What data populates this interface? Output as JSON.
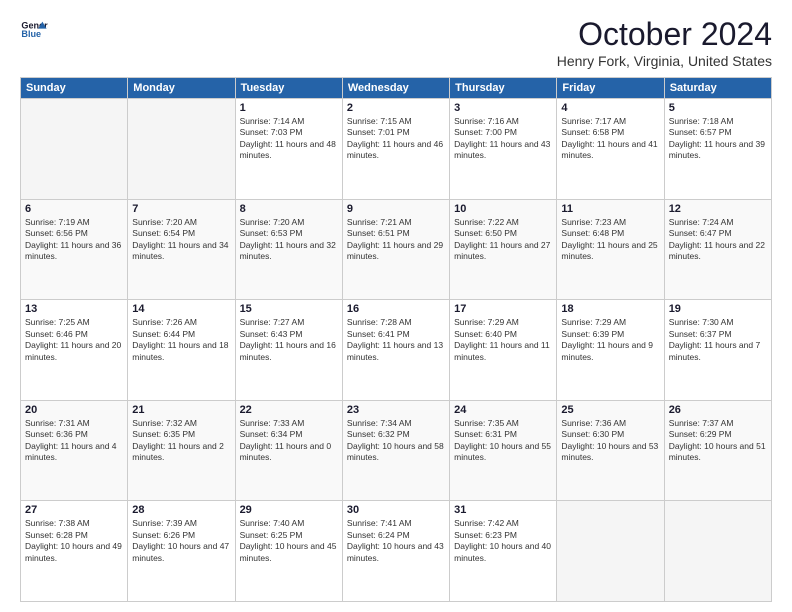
{
  "header": {
    "logo_line1": "General",
    "logo_line2": "Blue",
    "month": "October 2024",
    "location": "Henry Fork, Virginia, United States"
  },
  "weekdays": [
    "Sunday",
    "Monday",
    "Tuesday",
    "Wednesday",
    "Thursday",
    "Friday",
    "Saturday"
  ],
  "weeks": [
    [
      {
        "day": "",
        "empty": true
      },
      {
        "day": "",
        "empty": true
      },
      {
        "day": "1",
        "sunrise": "Sunrise: 7:14 AM",
        "sunset": "Sunset: 7:03 PM",
        "daylight": "Daylight: 11 hours and 48 minutes."
      },
      {
        "day": "2",
        "sunrise": "Sunrise: 7:15 AM",
        "sunset": "Sunset: 7:01 PM",
        "daylight": "Daylight: 11 hours and 46 minutes."
      },
      {
        "day": "3",
        "sunrise": "Sunrise: 7:16 AM",
        "sunset": "Sunset: 7:00 PM",
        "daylight": "Daylight: 11 hours and 43 minutes."
      },
      {
        "day": "4",
        "sunrise": "Sunrise: 7:17 AM",
        "sunset": "Sunset: 6:58 PM",
        "daylight": "Daylight: 11 hours and 41 minutes."
      },
      {
        "day": "5",
        "sunrise": "Sunrise: 7:18 AM",
        "sunset": "Sunset: 6:57 PM",
        "daylight": "Daylight: 11 hours and 39 minutes."
      }
    ],
    [
      {
        "day": "6",
        "sunrise": "Sunrise: 7:19 AM",
        "sunset": "Sunset: 6:56 PM",
        "daylight": "Daylight: 11 hours and 36 minutes."
      },
      {
        "day": "7",
        "sunrise": "Sunrise: 7:20 AM",
        "sunset": "Sunset: 6:54 PM",
        "daylight": "Daylight: 11 hours and 34 minutes."
      },
      {
        "day": "8",
        "sunrise": "Sunrise: 7:20 AM",
        "sunset": "Sunset: 6:53 PM",
        "daylight": "Daylight: 11 hours and 32 minutes."
      },
      {
        "day": "9",
        "sunrise": "Sunrise: 7:21 AM",
        "sunset": "Sunset: 6:51 PM",
        "daylight": "Daylight: 11 hours and 29 minutes."
      },
      {
        "day": "10",
        "sunrise": "Sunrise: 7:22 AM",
        "sunset": "Sunset: 6:50 PM",
        "daylight": "Daylight: 11 hours and 27 minutes."
      },
      {
        "day": "11",
        "sunrise": "Sunrise: 7:23 AM",
        "sunset": "Sunset: 6:48 PM",
        "daylight": "Daylight: 11 hours and 25 minutes."
      },
      {
        "day": "12",
        "sunrise": "Sunrise: 7:24 AM",
        "sunset": "Sunset: 6:47 PM",
        "daylight": "Daylight: 11 hours and 22 minutes."
      }
    ],
    [
      {
        "day": "13",
        "sunrise": "Sunrise: 7:25 AM",
        "sunset": "Sunset: 6:46 PM",
        "daylight": "Daylight: 11 hours and 20 minutes."
      },
      {
        "day": "14",
        "sunrise": "Sunrise: 7:26 AM",
        "sunset": "Sunset: 6:44 PM",
        "daylight": "Daylight: 11 hours and 18 minutes."
      },
      {
        "day": "15",
        "sunrise": "Sunrise: 7:27 AM",
        "sunset": "Sunset: 6:43 PM",
        "daylight": "Daylight: 11 hours and 16 minutes."
      },
      {
        "day": "16",
        "sunrise": "Sunrise: 7:28 AM",
        "sunset": "Sunset: 6:41 PM",
        "daylight": "Daylight: 11 hours and 13 minutes."
      },
      {
        "day": "17",
        "sunrise": "Sunrise: 7:29 AM",
        "sunset": "Sunset: 6:40 PM",
        "daylight": "Daylight: 11 hours and 11 minutes."
      },
      {
        "day": "18",
        "sunrise": "Sunrise: 7:29 AM",
        "sunset": "Sunset: 6:39 PM",
        "daylight": "Daylight: 11 hours and 9 minutes."
      },
      {
        "day": "19",
        "sunrise": "Sunrise: 7:30 AM",
        "sunset": "Sunset: 6:37 PM",
        "daylight": "Daylight: 11 hours and 7 minutes."
      }
    ],
    [
      {
        "day": "20",
        "sunrise": "Sunrise: 7:31 AM",
        "sunset": "Sunset: 6:36 PM",
        "daylight": "Daylight: 11 hours and 4 minutes."
      },
      {
        "day": "21",
        "sunrise": "Sunrise: 7:32 AM",
        "sunset": "Sunset: 6:35 PM",
        "daylight": "Daylight: 11 hours and 2 minutes."
      },
      {
        "day": "22",
        "sunrise": "Sunrise: 7:33 AM",
        "sunset": "Sunset: 6:34 PM",
        "daylight": "Daylight: 11 hours and 0 minutes."
      },
      {
        "day": "23",
        "sunrise": "Sunrise: 7:34 AM",
        "sunset": "Sunset: 6:32 PM",
        "daylight": "Daylight: 10 hours and 58 minutes."
      },
      {
        "day": "24",
        "sunrise": "Sunrise: 7:35 AM",
        "sunset": "Sunset: 6:31 PM",
        "daylight": "Daylight: 10 hours and 55 minutes."
      },
      {
        "day": "25",
        "sunrise": "Sunrise: 7:36 AM",
        "sunset": "Sunset: 6:30 PM",
        "daylight": "Daylight: 10 hours and 53 minutes."
      },
      {
        "day": "26",
        "sunrise": "Sunrise: 7:37 AM",
        "sunset": "Sunset: 6:29 PM",
        "daylight": "Daylight: 10 hours and 51 minutes."
      }
    ],
    [
      {
        "day": "27",
        "sunrise": "Sunrise: 7:38 AM",
        "sunset": "Sunset: 6:28 PM",
        "daylight": "Daylight: 10 hours and 49 minutes."
      },
      {
        "day": "28",
        "sunrise": "Sunrise: 7:39 AM",
        "sunset": "Sunset: 6:26 PM",
        "daylight": "Daylight: 10 hours and 47 minutes."
      },
      {
        "day": "29",
        "sunrise": "Sunrise: 7:40 AM",
        "sunset": "Sunset: 6:25 PM",
        "daylight": "Daylight: 10 hours and 45 minutes."
      },
      {
        "day": "30",
        "sunrise": "Sunrise: 7:41 AM",
        "sunset": "Sunset: 6:24 PM",
        "daylight": "Daylight: 10 hours and 43 minutes."
      },
      {
        "day": "31",
        "sunrise": "Sunrise: 7:42 AM",
        "sunset": "Sunset: 6:23 PM",
        "daylight": "Daylight: 10 hours and 40 minutes."
      },
      {
        "day": "",
        "empty": true
      },
      {
        "day": "",
        "empty": true
      }
    ]
  ],
  "row_styles": [
    "row-light",
    "row-dark",
    "row-light",
    "row-dark",
    "row-light"
  ]
}
